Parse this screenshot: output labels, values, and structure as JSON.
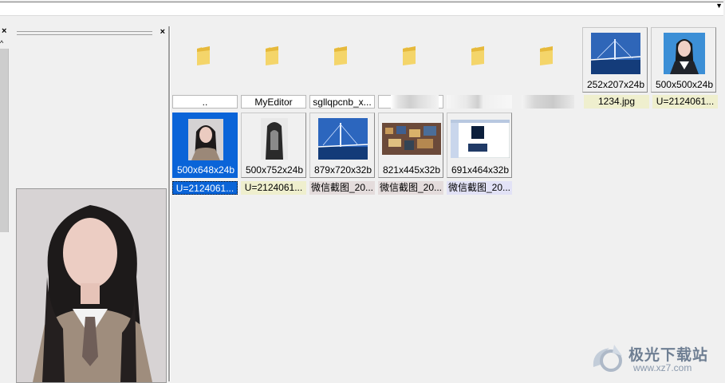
{
  "address_bar": {
    "value": ""
  },
  "left_pane": {
    "close_label": "×"
  },
  "preview_pane": {
    "close_label": "×"
  },
  "folders": [
    {
      "label": ".."
    },
    {
      "label": "MyEditor"
    },
    {
      "label": "sgllqpcnb_x..."
    },
    {
      "label": ""
    },
    {
      "label": ""
    },
    {
      "label": ""
    }
  ],
  "top_images": [
    {
      "dims": "252x207x24b",
      "name": "1234.jpg"
    },
    {
      "dims": "500x500x24b",
      "name": "U=2124061..."
    }
  ],
  "images": [
    {
      "dims": "500x648x24b",
      "name": "U=2124061...",
      "selected": true
    },
    {
      "dims": "500x752x24b",
      "name": "U=2124061..."
    },
    {
      "dims": "879x720x32b",
      "name": "微信截图_20..."
    },
    {
      "dims": "821x445x32b",
      "name": "微信截图_20..."
    },
    {
      "dims": "691x464x32b",
      "name": "微信截图_20..."
    }
  ],
  "watermark": {
    "text": "极光下载站",
    "url": "www.xz7.com"
  },
  "colors": {
    "selection": "#0a64d8",
    "name_yellow": "#efefce",
    "name_gray": "#e4dcdc",
    "name_lavender": "#e2e2f6"
  }
}
